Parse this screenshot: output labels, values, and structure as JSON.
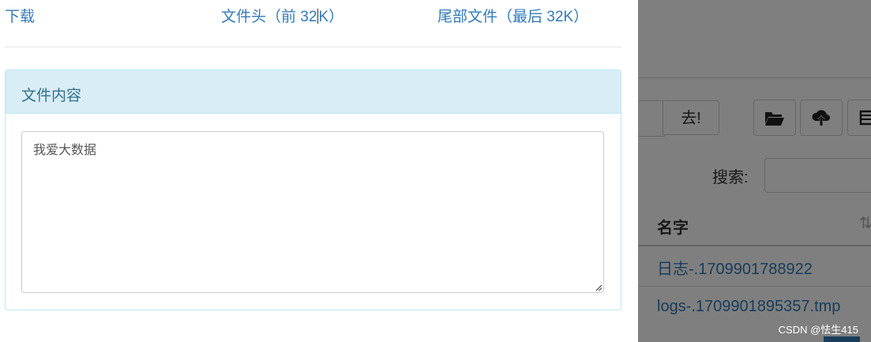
{
  "file_links": {
    "download": "下载",
    "head_prefix": "文件头（前 32",
    "head_suffix": "K）",
    "tail": "尾部文件（最后 32K）"
  },
  "panel": {
    "title": "文件内容",
    "content": "我爱大数据"
  },
  "background": {
    "goto_button": "去!",
    "search_label": "搜索:",
    "table_header_name": "名字",
    "files": [
      "日志-.1709901788922",
      "logs-.1709901895357.tmp"
    ]
  },
  "watermark": "CSDN @怯生415",
  "icons": [
    "folder-open-icon",
    "cloud-upload-icon",
    "table-icon",
    "sort-icon",
    "resize-grip-icon"
  ]
}
